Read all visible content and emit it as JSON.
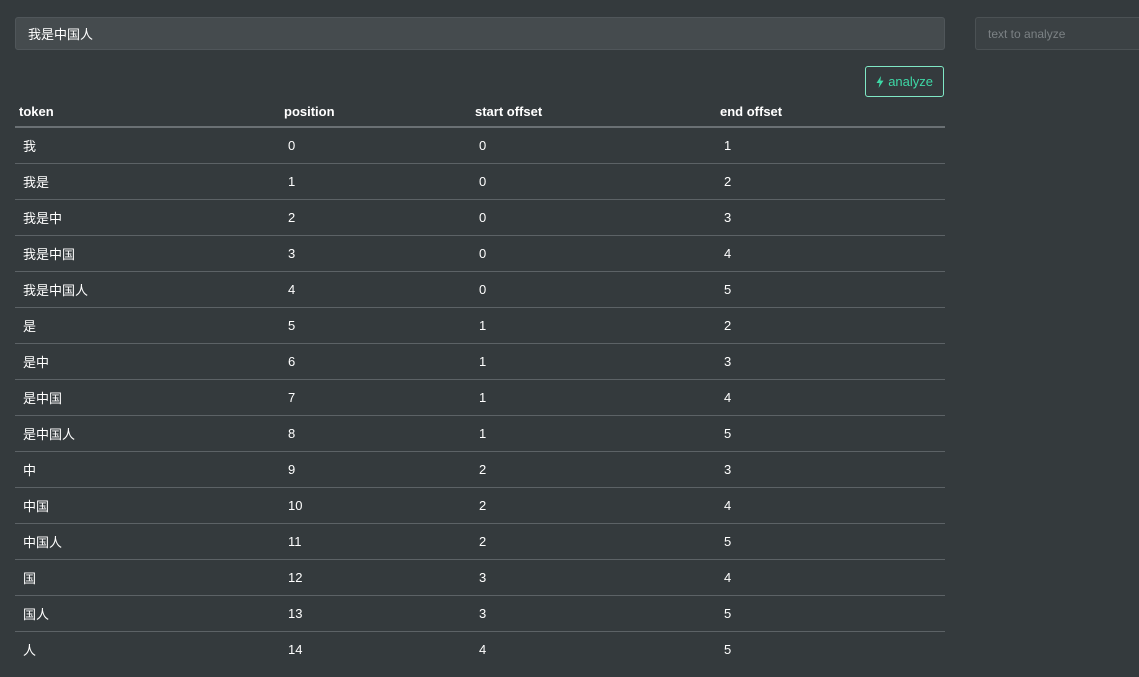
{
  "main_input": {
    "value": "我是中国人"
  },
  "side_input": {
    "placeholder": "text to analyze"
  },
  "analyze_button": {
    "label": "analyze",
    "icon": "bolt-icon",
    "color": "#3ed8a6"
  },
  "table": {
    "headers": [
      "token",
      "position",
      "start offset",
      "end offset"
    ],
    "rows": [
      [
        "我",
        "0",
        "0",
        "1"
      ],
      [
        "我是",
        "1",
        "0",
        "2"
      ],
      [
        "我是中",
        "2",
        "0",
        "3"
      ],
      [
        "我是中国",
        "3",
        "0",
        "4"
      ],
      [
        "我是中国人",
        "4",
        "0",
        "5"
      ],
      [
        "是",
        "5",
        "1",
        "2"
      ],
      [
        "是中",
        "6",
        "1",
        "3"
      ],
      [
        "是中国",
        "7",
        "1",
        "4"
      ],
      [
        "是中国人",
        "8",
        "1",
        "5"
      ],
      [
        "中",
        "9",
        "2",
        "3"
      ],
      [
        "中国",
        "10",
        "2",
        "4"
      ],
      [
        "中国人",
        "11",
        "2",
        "5"
      ],
      [
        "国",
        "12",
        "3",
        "4"
      ],
      [
        "国人",
        "13",
        "3",
        "5"
      ],
      [
        "人",
        "14",
        "4",
        "5"
      ]
    ]
  }
}
